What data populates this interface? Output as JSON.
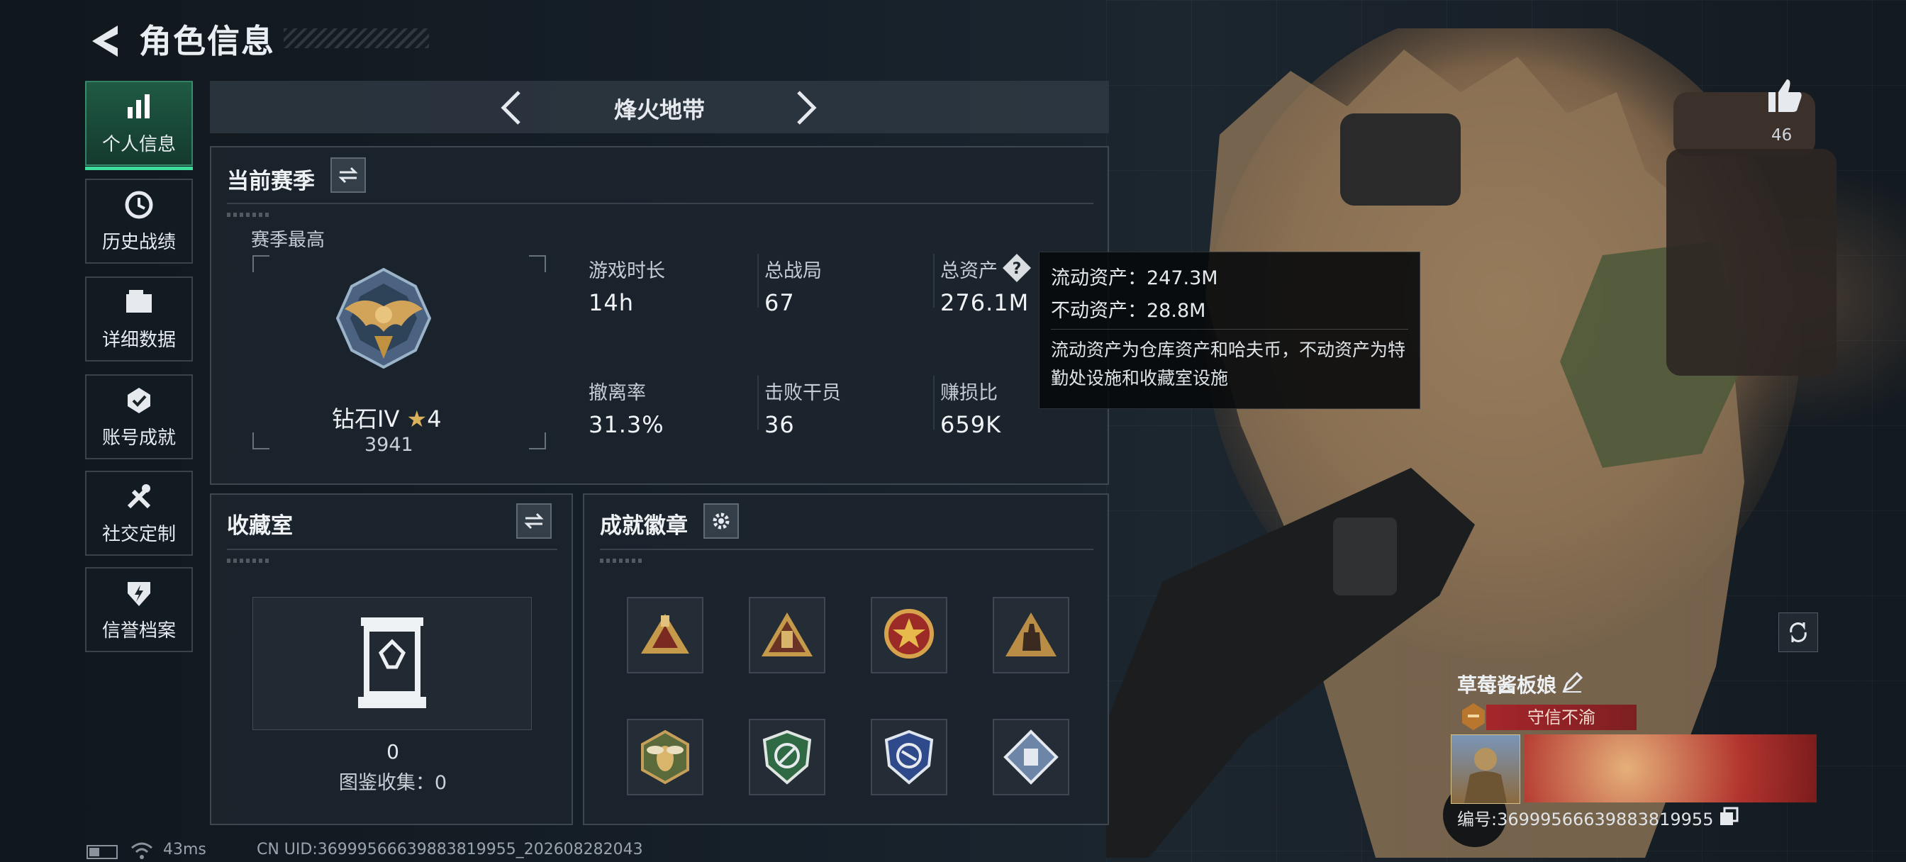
{
  "header": {
    "title": "角色信息"
  },
  "sidebar": {
    "items": [
      {
        "label": "个人信息",
        "icon": "bar-chart-icon",
        "active": true
      },
      {
        "label": "历史战绩",
        "icon": "history-icon"
      },
      {
        "label": "详细数据",
        "icon": "folder-icon"
      },
      {
        "label": "账号成就",
        "icon": "achievement-icon"
      },
      {
        "label": "社交定制",
        "icon": "tools-icon"
      },
      {
        "label": "信誉档案",
        "icon": "credit-icon"
      }
    ]
  },
  "mode": {
    "name": "烽火地带"
  },
  "season": {
    "title": "当前赛季",
    "best_label": "赛季最高",
    "rank_name": "钻石IV",
    "rank_stars": "4",
    "rank_score": "3941",
    "stats": [
      {
        "label": "游戏时长",
        "value": "14h"
      },
      {
        "label": "总战局",
        "value": "67"
      },
      {
        "label": "总资产",
        "value": "276.1M"
      },
      {
        "label": "撤离率",
        "value": "31.3%"
      },
      {
        "label": "击败干员",
        "value": "36"
      },
      {
        "label": "赚损比",
        "value": "659K"
      }
    ]
  },
  "tooltip": {
    "line1": "流动资产：247.3M",
    "line2": "不动资产：28.8M",
    "desc": "流动资产为仓库资产和哈夫币，不动资产为特勤处设施和收藏室设施"
  },
  "collection": {
    "title": "收藏室",
    "count": "0",
    "catalog": "图鉴收集：0"
  },
  "achievements": {
    "title": "成就徽章",
    "badges": [
      "badge-pyramid-icon",
      "badge-triangle-icon",
      "badge-star-medal-icon",
      "badge-hand-icon",
      "badge-bee-icon",
      "badge-green-shield-icon",
      "badge-blue-shield-icon",
      "badge-diamond-icon"
    ]
  },
  "player_card": {
    "likes": "46",
    "name": "草莓酱板娘",
    "title": "守信不渝",
    "id_text": "编号:3699956663988381995​5"
  },
  "footer": {
    "ping": "43ms",
    "uid": "CN UID:3699956663988381995​5_202608282043"
  },
  "colors": {
    "accent": "#3ddc9a",
    "rank_banner": "#a5262b"
  }
}
